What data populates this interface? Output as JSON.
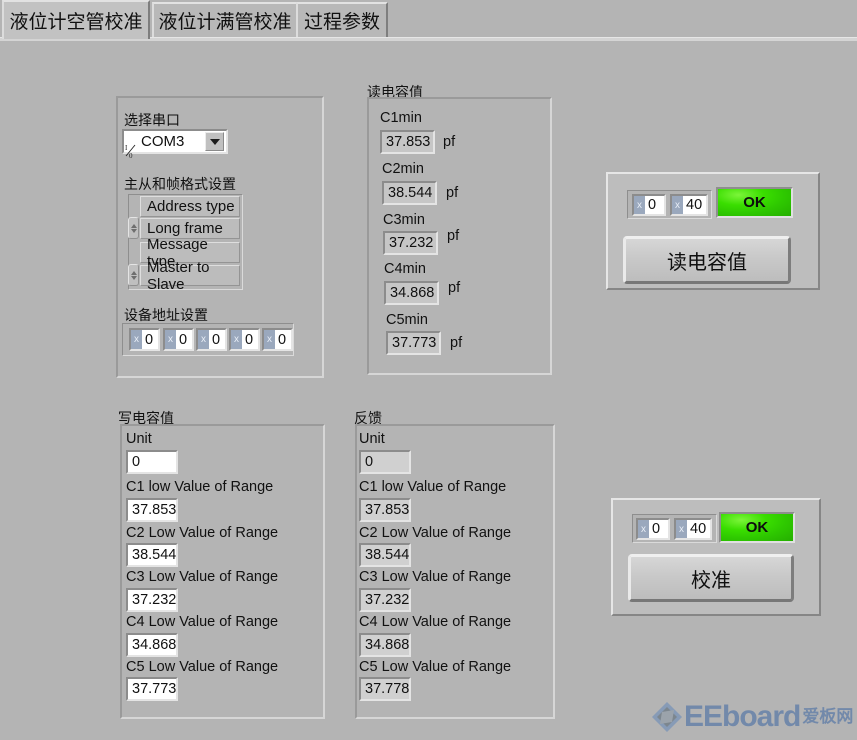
{
  "tabs": [
    {
      "label": "液位计空管校准",
      "active": true
    },
    {
      "label": "液位计满管校准",
      "active": false
    },
    {
      "label": "过程参数",
      "active": false
    }
  ],
  "serial_panel": {
    "port_label": "选择串口",
    "port_value": "COM3",
    "port_icon": "io-refnum-icon",
    "frame_label": "主从和帧格式设置",
    "address_type_label": "Address type",
    "address_type_value": "Long frame",
    "message_type_label": "Message type",
    "message_type_value": "Master to Slave",
    "device_address_label": "设备地址设置",
    "address_bytes": [
      {
        "radix": "x",
        "value": "0"
      },
      {
        "radix": "x",
        "value": "0"
      },
      {
        "radix": "x",
        "value": "0"
      },
      {
        "radix": "x",
        "value": "0"
      },
      {
        "radix": "x",
        "value": "0"
      }
    ]
  },
  "read_panel": {
    "title": "读电容值",
    "rows": [
      {
        "label": "C1min",
        "value": "37.853",
        "unit": "pf"
      },
      {
        "label": "C2min",
        "value": "38.544",
        "unit": "pf"
      },
      {
        "label": "C3min",
        "value": "37.232",
        "unit": "pf"
      },
      {
        "label": "C4min",
        "value": "34.868",
        "unit": "pf"
      },
      {
        "label": "C5min",
        "value": "37.773",
        "unit": "pf"
      }
    ]
  },
  "read_action": {
    "byte1": {
      "radix": "x",
      "value": "0"
    },
    "byte2": {
      "radix": "x",
      "value": "40"
    },
    "status": "OK",
    "status_color": "#33d900",
    "button_label": "读电容值"
  },
  "write_panel": {
    "title": "写电容值",
    "rows": [
      {
        "label": "Unit",
        "value": "0"
      },
      {
        "label": "C1 low Value of Range",
        "value": "37.853"
      },
      {
        "label": "C2 Low Value of Range",
        "value": "38.544"
      },
      {
        "label": "C3 Low Value of Range",
        "value": "37.232"
      },
      {
        "label": "C4 Low Value of Range",
        "value": "34.868"
      },
      {
        "label": "C5 Low Value of Range",
        "value": "37.773"
      }
    ]
  },
  "feedback_panel": {
    "title": "反馈",
    "rows": [
      {
        "label": "Unit",
        "value": "0"
      },
      {
        "label": "C1 low Value of Range",
        "value": "37.853"
      },
      {
        "label": "C2 Low Value of Range",
        "value": "38.544"
      },
      {
        "label": "C3 Low Value of Range",
        "value": "37.232"
      },
      {
        "label": "C4 Low Value of Range",
        "value": "34.868"
      },
      {
        "label": "C5 Low Value of Range",
        "value": "37.778"
      }
    ]
  },
  "calibrate_action": {
    "byte1": {
      "radix": "x",
      "value": "0"
    },
    "byte2": {
      "radix": "x",
      "value": "40"
    },
    "status": "OK",
    "status_color": "#33d900",
    "button_label": "校准"
  },
  "watermark": {
    "text": "EEboard",
    "cn": "爱板网"
  }
}
